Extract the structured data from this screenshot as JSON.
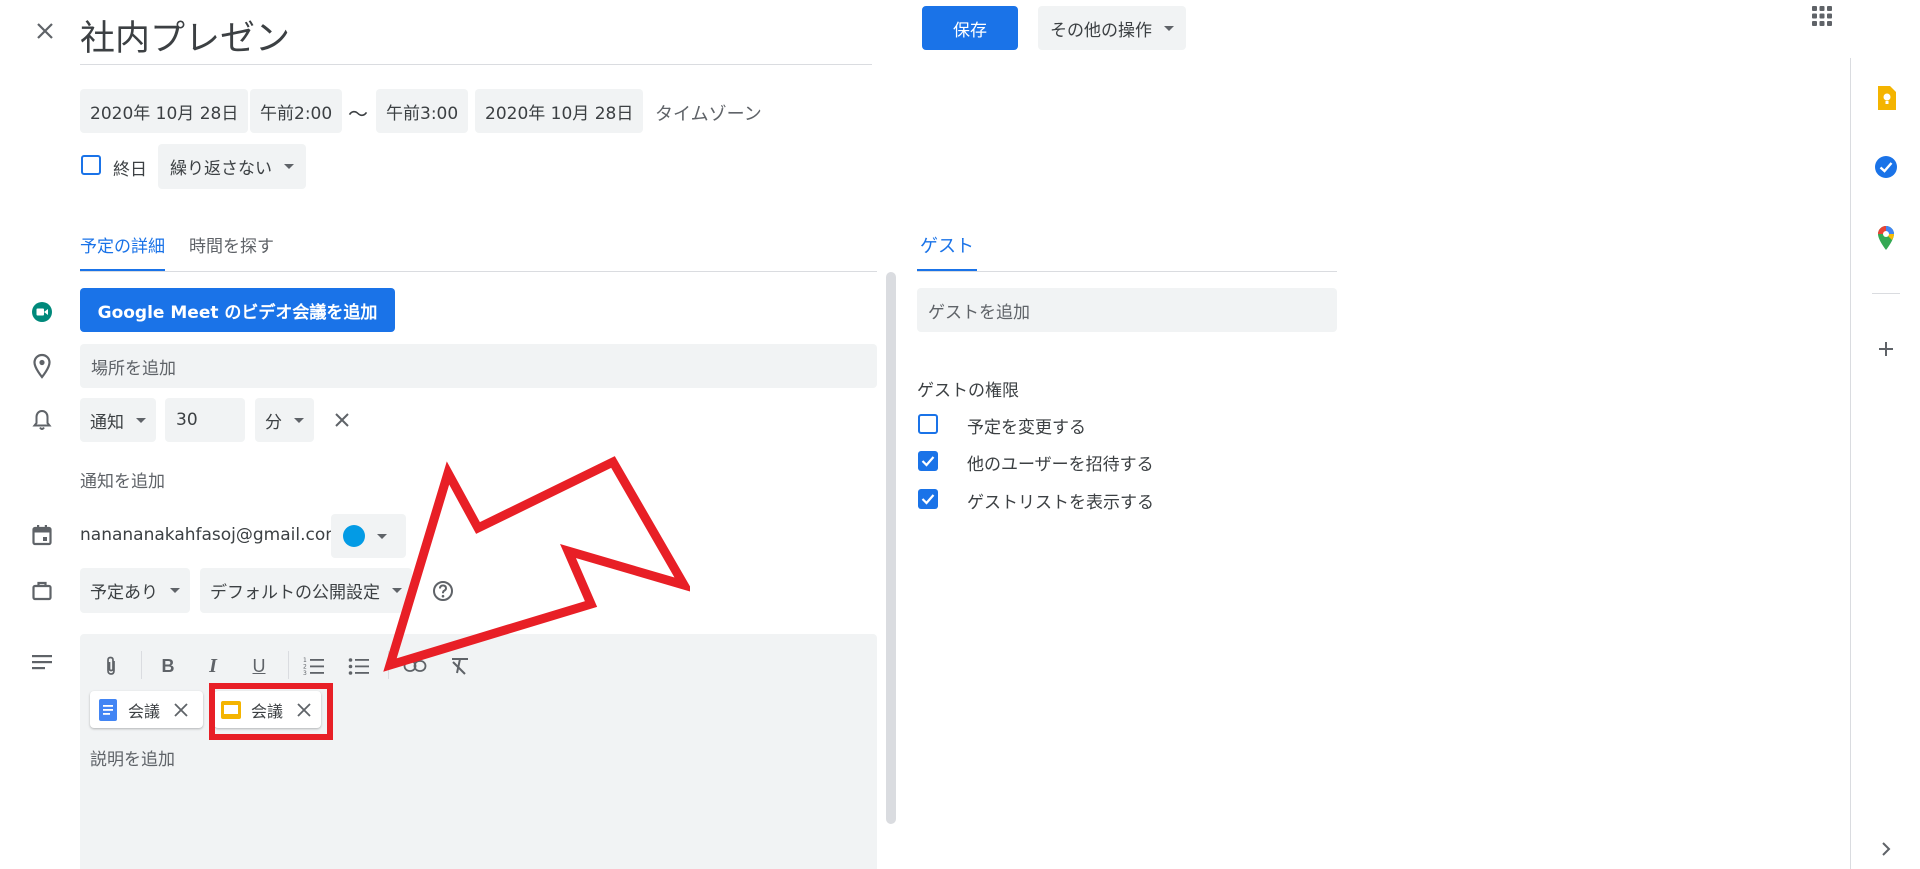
{
  "header": {
    "title": "社内プレゼン",
    "save_label": "保存",
    "more_actions_label": "その他の操作"
  },
  "datetime": {
    "start_date": "2020年 10月 28日",
    "start_time": "午前2:00",
    "separator": "〜",
    "end_time": "午前3:00",
    "end_date": "2020年 10月 28日",
    "timezone_label": "タイムゾーン",
    "all_day_label": "終日",
    "repeat_label": "繰り返さない"
  },
  "tabs": {
    "details": "予定の詳細",
    "find_time": "時間を探す",
    "guests": "ゲスト"
  },
  "details": {
    "meet_button": "Google Meet のビデオ会議を追加",
    "location_placeholder": "場所を追加",
    "notification_type": "通知",
    "notification_value": "30",
    "notification_unit": "分",
    "add_notification": "通知を追加",
    "calendar_email": "nanananakahfasoj@gmail.com",
    "calendar_color": "#039be5",
    "busy_status": "予定あり",
    "visibility": "デフォルトの公開設定",
    "attachments": [
      {
        "label": "会議",
        "icon": "google-docs-icon",
        "color": "#4285f4"
      },
      {
        "label": "会議",
        "icon": "google-slides-icon",
        "color": "#f4b400"
      }
    ],
    "description_placeholder": "説明を追加"
  },
  "guests": {
    "add_placeholder": "ゲストを追加",
    "permissions_title": "ゲストの権限",
    "permissions": [
      {
        "label": "予定を変更する",
        "checked": false
      },
      {
        "label": "他のユーザーを招待する",
        "checked": true
      },
      {
        "label": "ゲストリストを表示する",
        "checked": true
      }
    ]
  },
  "colors": {
    "accent": "#1a73e8",
    "annotation_red": "#e81f26"
  }
}
